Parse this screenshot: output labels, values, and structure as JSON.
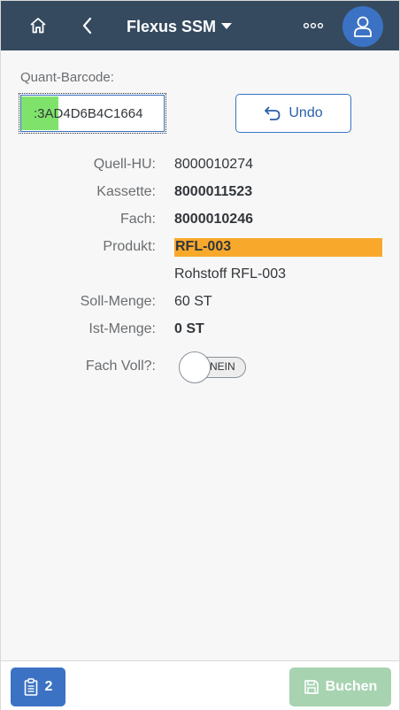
{
  "header": {
    "title": "Flexus SSM",
    "home_icon": "home-icon",
    "back_icon": "chevron-left-icon",
    "title_dropdown_icon": "caret-down-icon",
    "more_icon": "more-options-icon",
    "avatar_icon": "user-icon"
  },
  "form": {
    "barcode_label": "Quant-Barcode:",
    "barcode_value": ":3AD4D6B4C1664",
    "undo_label": "Undo"
  },
  "details": {
    "quell_hu_label": "Quell-HU:",
    "quell_hu_value": "8000010274",
    "kassette_label": "Kassette:",
    "kassette_value": "8000011523",
    "fach_label": "Fach:",
    "fach_value": "8000010246",
    "produkt_label": "Produkt:",
    "produkt_value": "RFL-003",
    "produkt_description": "Rohstoff RFL-003",
    "soll_menge_label": "Soll-Menge:",
    "soll_menge_value": "60 ST",
    "ist_menge_label": "Ist-Menge:",
    "ist_menge_value": "0 ST",
    "fach_voll_label": "Fach Voll?:",
    "fach_voll_toggle_text": "NEIN"
  },
  "footer": {
    "tasks_count": "2",
    "tasks_icon": "clipboard-icon",
    "buchen_label": "Buchen",
    "buchen_icon": "save-icon"
  },
  "colors": {
    "header_bg": "#354a5f",
    "accent": "#3b72c4",
    "produkt_highlight": "#f8a92b",
    "barcode_highlight": "#7fe36b",
    "buchen_disabled": "#a7d3b0"
  }
}
